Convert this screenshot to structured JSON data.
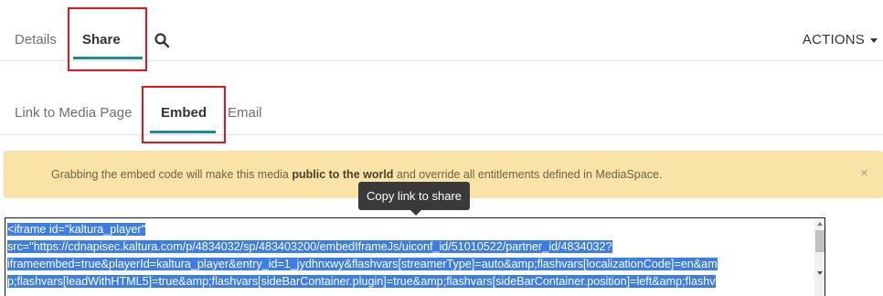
{
  "top_tabs": {
    "details": "Details",
    "share": "Share",
    "actions": "ACTIONS"
  },
  "sub_tabs": {
    "link": "Link to Media Page",
    "embed": "Embed",
    "email": "Email"
  },
  "banner": {
    "prefix": "Grabbing the embed code will make this media ",
    "bold": "public to the world",
    "suffix": " and override all entitlements defined in MediaSpace.",
    "close": "×"
  },
  "tooltip": "Copy link to share",
  "embed_code": "<iframe id=\"kaltura_player\" src=\"https://cdnapisec.kaltura.com/p/4834032/sp/483403200/embedIframeJs/uiconf_id/51010522/partner_id/4834032?iframeembed=true&playerId=kaltura_player&entry_id=1_jydhnxwy&flashvars[streamerType]=auto&amp;flashvars[localizationCode]=en&amp;flashvars[leadWithHTML5]=true&amp;flashvars[sideBarContainer.plugin]=true&amp;flashvars[sideBarContainer.position]=left&amp;flashvars[sideBarContainer.clickToClose]=true&amp;flashvars[chapters.plugin]=true",
  "embed_lines": [
    "<iframe id=\"kaltura_player\"",
    "src=\"https://cdnapisec.kaltura.com/p/4834032/sp/483403200/embedIframeJs/uiconf_id/51010522/partner_id/4834032?",
    "iframeembed=true&playerId=kaltura_player&entry_id=1_jydhnxwy&flashvars[streamerType]=auto&amp;flashvars[localizationCode]=en&am",
    "p;flashvars[leadWithHTML5]=true&amp;flashvars[sideBarContainer.plugin]=true&amp;flashvars[sideBarContainer.position]=left&amp;flashv"
  ],
  "colors": {
    "accent": "#1f8a9b",
    "highlight_box": "#e8141c",
    "banner_bg": "#fae3a6",
    "selection": "#3d7ee6"
  }
}
